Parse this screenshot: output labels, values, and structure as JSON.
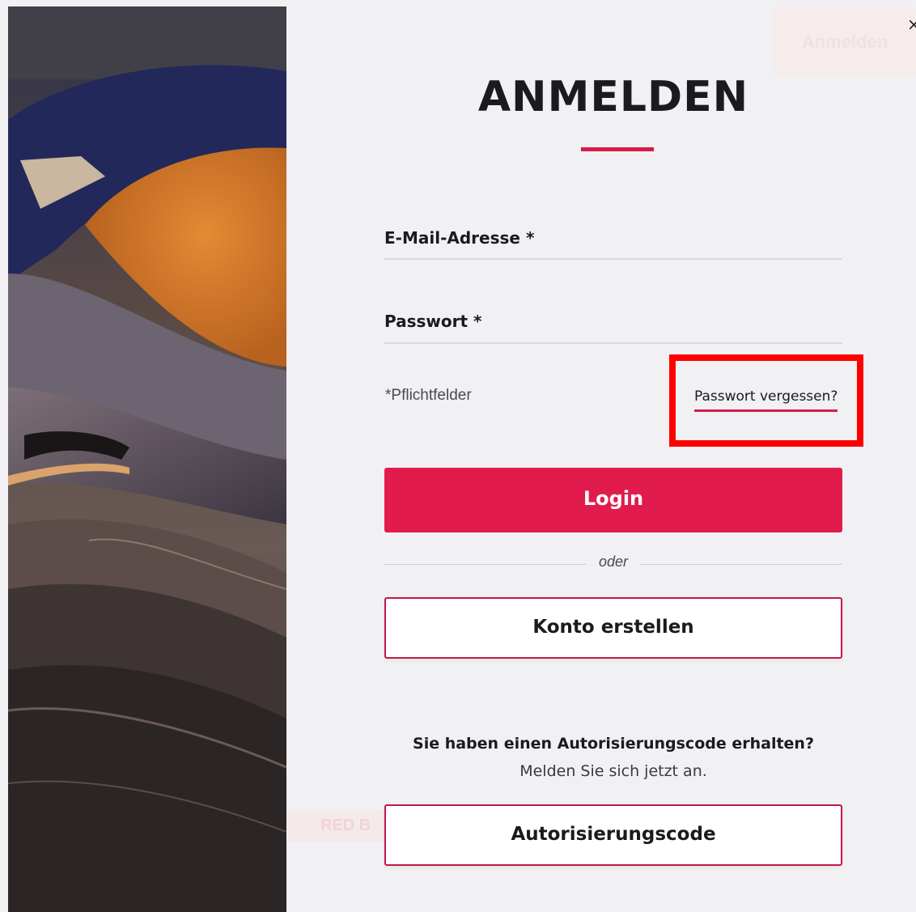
{
  "modal": {
    "close_symbol": "×",
    "title": "ANMELDEN",
    "email_label": "E-Mail-Adresse",
    "password_label": "Passwort",
    "required_marker": "*",
    "required_hint": "*Pflichtfelder",
    "forgot_password": "Passwort vergessen?",
    "login_button": "Login",
    "divider_text": "oder",
    "create_account_button": "Konto erstellen",
    "auth_heading": "Sie haben einen Autorisierungscode erhalten?",
    "auth_subtext": "Melden Sie sich jetzt an.",
    "auth_code_button": "Autorisierungscode"
  },
  "background": {
    "top_button": "Anmelden",
    "red_text": "RED B"
  },
  "colors": {
    "accent": "#e11c4d",
    "highlight": "#ff0000"
  }
}
